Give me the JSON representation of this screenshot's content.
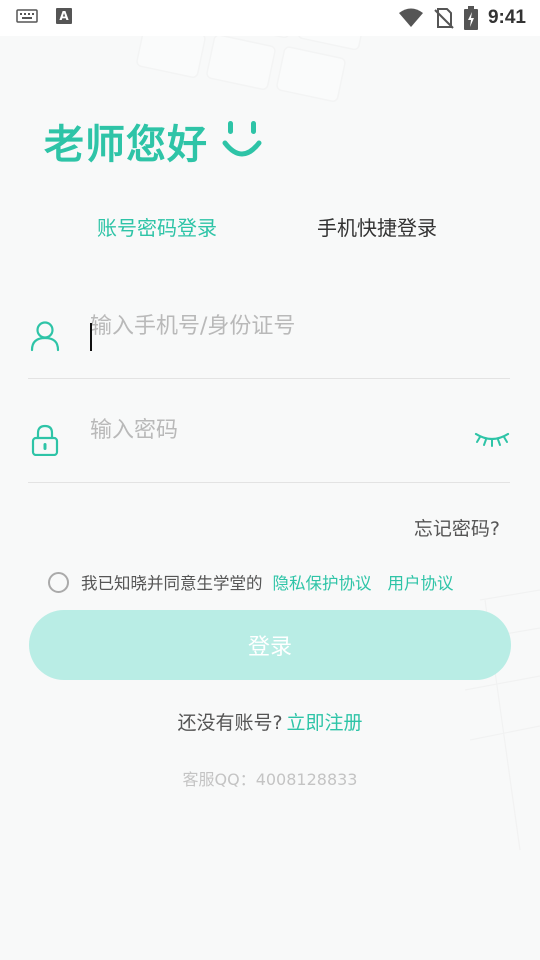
{
  "status_bar": {
    "time": "9:41",
    "left_icons": [
      "keyboard-icon",
      "font-a-icon"
    ],
    "right_icons": [
      "wifi-icon",
      "no-sim-icon",
      "battery-icon"
    ],
    "font_icon_letter": "A"
  },
  "greeting": {
    "title": "老师您好",
    "icon": "smile-icon"
  },
  "tabs": [
    {
      "label": "账号密码登录",
      "active": true
    },
    {
      "label": "手机快捷登录",
      "active": false
    }
  ],
  "fields": {
    "account": {
      "placeholder": "输入手机号/身份证号",
      "value": "",
      "icon": "user-icon"
    },
    "password": {
      "placeholder": "输入密码",
      "value": "",
      "icon": "lock-icon",
      "toggle_icon": "eye-closed-icon"
    }
  },
  "forgot_password": "忘记密码?",
  "agreement": {
    "checked": false,
    "text": "我已知晓并同意生学堂的",
    "privacy_link": "隐私保护协议",
    "user_link": "用户协议"
  },
  "login_button": "登录",
  "register": {
    "question": "还没有账号?",
    "link": "立即注册"
  },
  "service": "客服QQ：4008128833",
  "colors": {
    "accent": "#2ec4a7",
    "button_disabled": "#b9ede5",
    "background": "#f8f9f9"
  }
}
